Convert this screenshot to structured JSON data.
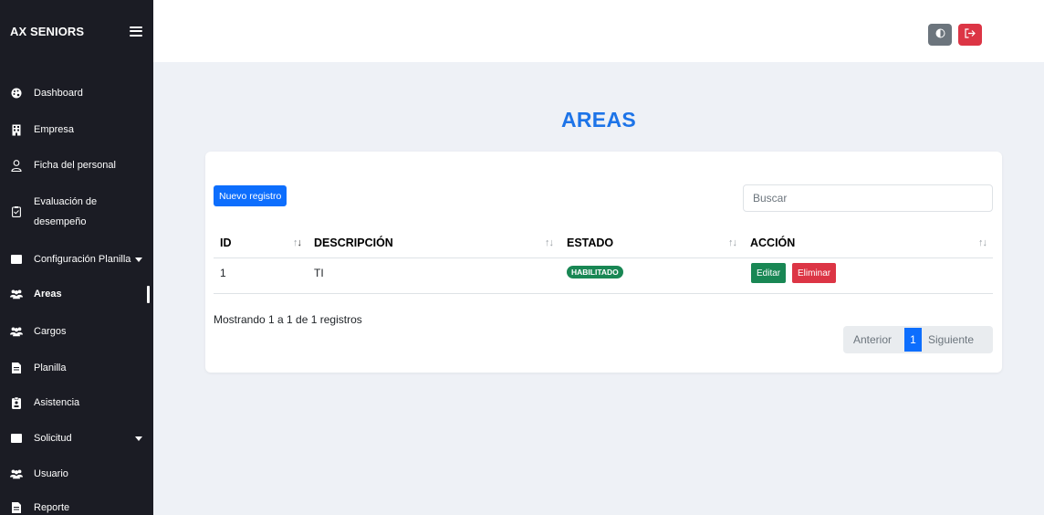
{
  "app": {
    "brand": "AX SENIORS"
  },
  "sidebar": {
    "items": [
      {
        "label": "Dashboard",
        "icon": "palette-icon"
      },
      {
        "label": "Empresa",
        "icon": "building-icon"
      },
      {
        "label": "Ficha del personal",
        "icon": "user-icon"
      },
      {
        "label_line1": "Evaluación de",
        "label_line2": "desempeño",
        "icon": "clipboard-icon"
      },
      {
        "label": "Configuración Planilla",
        "icon": "folder-icon",
        "has_caret": true
      },
      {
        "label": "Areas",
        "icon": "users-icon",
        "active": true
      },
      {
        "label": "Cargos",
        "icon": "users-icon"
      },
      {
        "label": "Planilla",
        "icon": "file-icon"
      },
      {
        "label": "Asistencia",
        "icon": "id-badge-icon"
      },
      {
        "label": "Solicitud",
        "icon": "folder-icon",
        "has_caret": true
      },
      {
        "label": "Usuario",
        "icon": "users-icon"
      },
      {
        "label": "Reporte",
        "icon": "file-icon"
      }
    ]
  },
  "topbar": {
    "theme_icon": "contrast-icon",
    "logout_icon": "logout-icon"
  },
  "main": {
    "title": "AREAS",
    "new_button": "Nuevo registro",
    "search": {
      "placeholder": "Buscar",
      "value": ""
    },
    "table": {
      "columns": [
        "ID",
        "DESCRIPCIÓN",
        "ESTADO",
        "ACCIÓN"
      ],
      "rows": [
        {
          "id": "1",
          "descripcion": "TI",
          "estado": "HABILITADO",
          "actions": [
            "Editar",
            "Eliminar"
          ]
        }
      ]
    },
    "info": "Mostrando 1 a 1 de 1 registros",
    "pagination": {
      "prev": "Anterior",
      "current": "1",
      "next": "Siguiente"
    }
  },
  "colors": {
    "sidebar_bg": "#1b1c24",
    "accent": "#1d74e8",
    "primary": "#0d6efd",
    "success": "#198754",
    "danger": "#dc3545",
    "secondary": "#6c757d",
    "content_bg": "#eef1f6"
  }
}
